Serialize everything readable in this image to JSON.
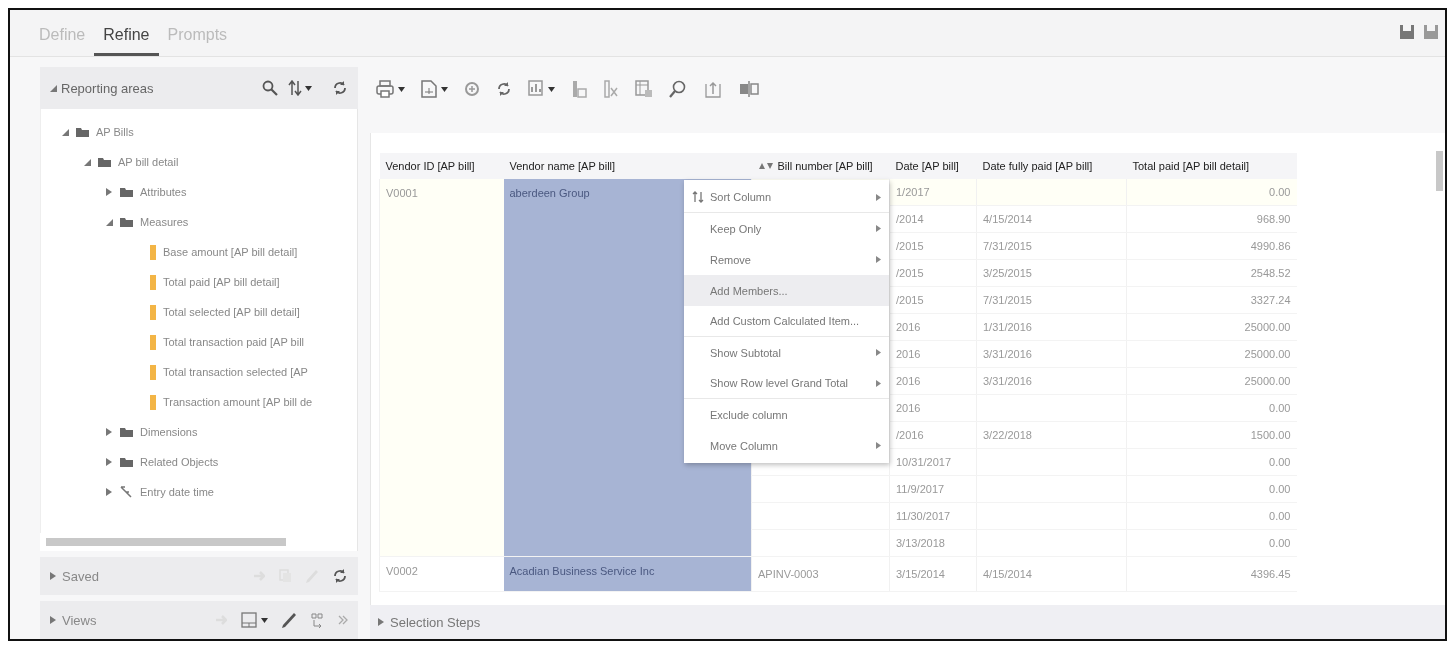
{
  "tabs": [
    {
      "label": "Define",
      "selected": false
    },
    {
      "label": "Refine",
      "selected": true
    },
    {
      "label": "Prompts",
      "selected": false
    }
  ],
  "reporting_areas": {
    "title": "Reporting areas",
    "expanded": true,
    "tree": [
      {
        "label": "AP Bills",
        "kind": "folder",
        "expanded": true,
        "children": [
          {
            "label": "AP bill detail",
            "kind": "folder",
            "expanded": true,
            "children": [
              {
                "label": "Attributes",
                "kind": "folder",
                "expanded": false
              },
              {
                "label": "Measures",
                "kind": "folder",
                "expanded": true,
                "children": [
                  {
                    "label": "Base amount [AP bill detail]",
                    "kind": "measure"
                  },
                  {
                    "label": "Total paid [AP bill detail]",
                    "kind": "measure"
                  },
                  {
                    "label": "Total selected [AP bill detail]",
                    "kind": "measure"
                  },
                  {
                    "label": "Total transaction paid [AP bill",
                    "kind": "measure"
                  },
                  {
                    "label": "Total transaction selected [AP",
                    "kind": "measure"
                  },
                  {
                    "label": "Transaction amount [AP bill de",
                    "kind": "measure"
                  }
                ]
              },
              {
                "label": "Dimensions",
                "kind": "folder",
                "expanded": false
              },
              {
                "label": "Related Objects",
                "kind": "folder",
                "expanded": false
              },
              {
                "label": "Entry date time",
                "kind": "hierarchy",
                "expanded": false
              }
            ]
          }
        ]
      }
    ]
  },
  "saved": {
    "label": "Saved",
    "expanded": false
  },
  "views": {
    "label": "Views",
    "expanded": false
  },
  "selection_steps": {
    "label": "Selection Steps",
    "expanded": false
  },
  "table": {
    "columns": [
      {
        "label": "Vendor ID [AP bill]",
        "selected": false,
        "sort_icon": false
      },
      {
        "label": "Vendor name [AP bill]",
        "selected": true,
        "sort_icon": false
      },
      {
        "label": "Bill number [AP bill]",
        "selected": false,
        "sort_icon": true
      },
      {
        "label": "Date [AP bill]",
        "selected": false,
        "sort_icon": false
      },
      {
        "label": "Date fully paid [AP bill]",
        "selected": false,
        "sort_icon": false
      },
      {
        "label": "Total paid [AP bill detail]",
        "selected": false,
        "sort_icon": false
      }
    ],
    "groups": [
      {
        "vendor_id": "V0001",
        "vendor_name": "aberdeen Group",
        "rows": [
          {
            "date": "1/2017",
            "total_paid": "0.00"
          },
          {
            "date": "/2014",
            "date_fully_paid": "4/15/2014",
            "total_paid": "968.90"
          },
          {
            "date": "/2015",
            "date_fully_paid": "7/31/2015",
            "total_paid": "4990.86"
          },
          {
            "date": "/2015",
            "date_fully_paid": "3/25/2015",
            "total_paid": "2548.52"
          },
          {
            "date": "/2015",
            "date_fully_paid": "7/31/2015",
            "total_paid": "3327.24"
          },
          {
            "date": "2016",
            "date_fully_paid": "1/31/2016",
            "total_paid": "25000.00"
          },
          {
            "date": "2016",
            "date_fully_paid": "3/31/2016",
            "total_paid": "25000.00"
          },
          {
            "date": "2016",
            "date_fully_paid": "3/31/2016",
            "total_paid": "25000.00"
          },
          {
            "date": "2016",
            "total_paid": "0.00"
          },
          {
            "date": "/2016",
            "date_fully_paid": "3/22/2018",
            "total_paid": "1500.00"
          },
          {
            "date": "10/31/2017",
            "total_paid": "0.00"
          },
          {
            "date": "11/9/2017",
            "total_paid": "0.00"
          },
          {
            "date": "11/30/2017",
            "total_paid": "0.00"
          },
          {
            "date": "3/13/2018",
            "total_paid": "0.00"
          }
        ]
      },
      {
        "vendor_id": "V0002",
        "vendor_name": "Acadian Business Service Inc",
        "rows": [
          {
            "bill_number": "APINV-0003",
            "date": "3/15/2014",
            "date_fully_paid": "4/15/2014",
            "total_paid": "4396.45"
          }
        ]
      }
    ]
  },
  "context_menu": [
    {
      "label": "Sort Column",
      "has_submenu": true,
      "highlighted": false,
      "separator_after": true,
      "kind": "sort"
    },
    {
      "label": "Keep Only",
      "has_submenu": true,
      "highlighted": false,
      "separator_after": false,
      "kind": "plain"
    },
    {
      "label": "Remove",
      "has_submenu": true,
      "highlighted": false,
      "separator_after": false,
      "kind": "plain"
    },
    {
      "label": "Add Members...",
      "has_submenu": false,
      "highlighted": true,
      "separator_after": false,
      "kind": "plain"
    },
    {
      "label": "Add Custom Calculated Item...",
      "has_submenu": false,
      "highlighted": false,
      "separator_after": true,
      "kind": "plain"
    },
    {
      "label": "Show Subtotal",
      "has_submenu": true,
      "highlighted": false,
      "separator_after": false,
      "kind": "plain"
    },
    {
      "label": "Show Row level Grand Total",
      "has_submenu": true,
      "highlighted": false,
      "separator_after": true,
      "kind": "plain"
    },
    {
      "label": "Exclude column",
      "has_submenu": false,
      "highlighted": false,
      "separator_after": false,
      "kind": "plain"
    },
    {
      "label": "Move Column",
      "has_submenu": true,
      "highlighted": false,
      "separator_after": false,
      "kind": "plain"
    }
  ]
}
